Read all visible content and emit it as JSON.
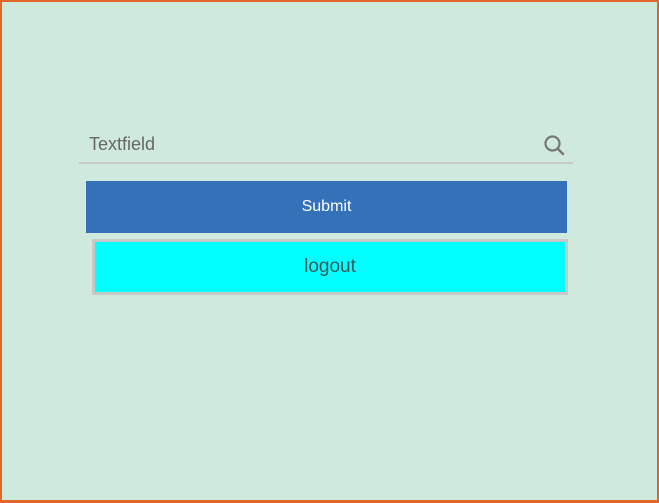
{
  "form": {
    "textfield": {
      "placeholder": "Textfield",
      "value": ""
    },
    "search_icon": "search-icon",
    "submit_label": "Submit",
    "logout_label": "logout"
  },
  "colors": {
    "background": "#cfe9dc",
    "frame_border": "#e0662a",
    "submit_bg": "#3471b8",
    "logout_bg": "#00ffff"
  }
}
